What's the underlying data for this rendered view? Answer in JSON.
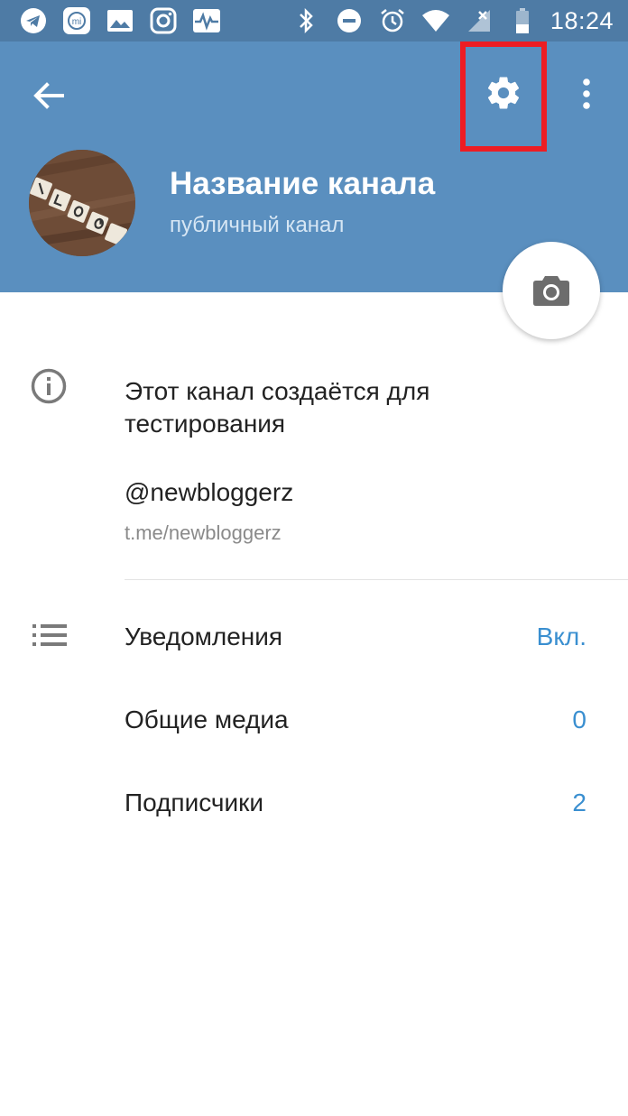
{
  "status_bar": {
    "time": "18:24",
    "left_icons": [
      "telegram-icon",
      "mi-icon",
      "gallery-icon",
      "instagram-icon",
      "activity-icon"
    ],
    "right_icons": [
      "bluetooth-icon",
      "do-not-disturb-icon",
      "alarm-icon",
      "wifi-icon",
      "signal-icon",
      "battery-icon"
    ]
  },
  "header": {
    "back_icon": "arrow-back-icon",
    "settings_icon": "gear-icon",
    "more_icon": "more-vertical-icon",
    "title": "Название канала",
    "subtitle": "публичный канал",
    "highlight_color": "#ee1d23",
    "background_color": "#5a8fbf"
  },
  "camera_button": {
    "icon": "camera-icon"
  },
  "info": {
    "icon": "info-icon",
    "description": "Этот канал создаётся для тестирования",
    "username": "@newbloggerz",
    "link": "t.me/newbloggerz"
  },
  "rows": [
    {
      "label": "Уведомления",
      "value": "Вкл.",
      "icon": "list-icon"
    },
    {
      "label": "Общие медиа",
      "value": "0"
    },
    {
      "label": "Подписчики",
      "value": "2"
    }
  ],
  "accent_color": "#3a8fd0"
}
